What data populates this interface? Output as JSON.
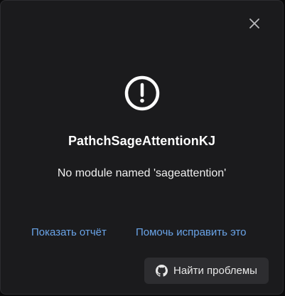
{
  "dialog": {
    "close_icon": "close-icon",
    "status_icon": "exclamation-circle-icon",
    "title": "PathchSageAttentionKJ",
    "message": "No module named 'sageattention'",
    "links": {
      "report": "Показать отчёт",
      "help": "Помочь исправить это"
    },
    "find_button": {
      "icon": "github-icon",
      "label": "Найти проблемы"
    }
  },
  "colors": {
    "background": "#1b1b1d",
    "link": "#6aa4e8",
    "button_bg": "#2d2d30",
    "text": "#ffffff"
  }
}
